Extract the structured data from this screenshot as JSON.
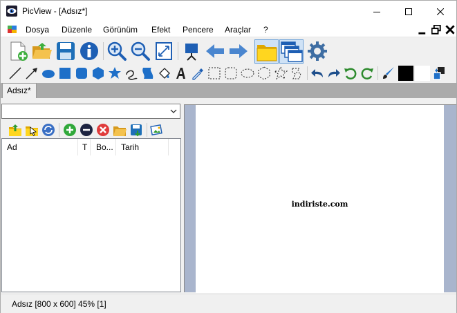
{
  "window": {
    "title": "PicView - [Adsız*]"
  },
  "menu": {
    "items": [
      "Dosya",
      "Düzenle",
      "Görünüm",
      "Efekt",
      "Pencere",
      "Araçlar",
      "?"
    ]
  },
  "toolbar_main": {
    "icons": [
      "new-file-icon",
      "open-folder-icon",
      "save-icon",
      "info-icon",
      "zoom-in-icon",
      "zoom-out-icon",
      "fit-page-icon",
      "slideshow-icon",
      "previous-arrow-icon",
      "next-arrow-icon",
      "folder-view-icon",
      "cascade-windows-icon",
      "settings-gear-icon"
    ]
  },
  "toolbar_draw": {
    "icons": [
      "line-tool-icon",
      "arrow-tool-icon",
      "ellipse-tool-icon",
      "rectangle-tool-icon",
      "rounded-rectangle-tool-icon",
      "hexagon-tool-icon",
      "star-tool-icon",
      "freehand-tool-icon",
      "shape-tool-icon",
      "fill-tool-icon",
      "text-tool-icon",
      "color-picker-icon",
      "rect-select-icon",
      "rounded-select-icon",
      "ellipse-select-icon",
      "hexagon-select-icon",
      "star-select-icon",
      "lasso-select-icon",
      "undo-icon",
      "redo-icon",
      "rotate-left-icon",
      "rotate-right-icon",
      "brush-icon",
      "foreground-color-swatch",
      "background-color-swatch",
      "swap-colors-icon"
    ]
  },
  "colors": {
    "foreground": "#000000",
    "background": "#ffffff",
    "canvas_bg": "#a9b5cd"
  },
  "tabs": [
    {
      "label": "Adsız*"
    }
  ],
  "browser": {
    "path_value": "",
    "columns": [
      "Ad",
      "T",
      "Bo...",
      "Tarih"
    ],
    "rows": []
  },
  "canvas": {
    "text": "indiriste.com"
  },
  "status": {
    "text": "Adsız [800 x 600] 45% [1]"
  }
}
